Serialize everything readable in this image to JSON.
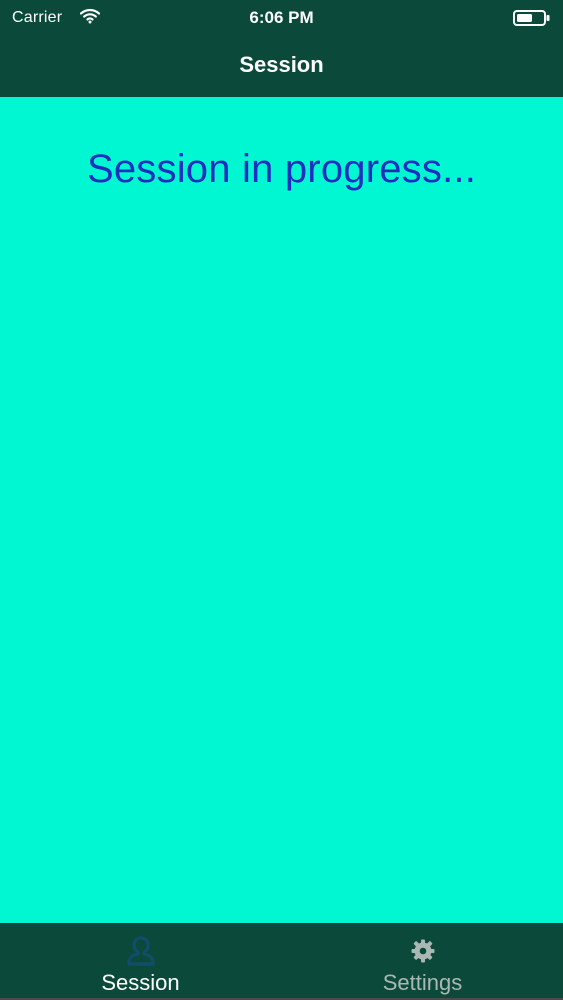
{
  "status_bar": {
    "carrier": "Carrier",
    "time": "6:06 PM",
    "wifi_icon": "wifi-icon",
    "battery_icon": "battery-icon"
  },
  "nav": {
    "title": "Session"
  },
  "main": {
    "status_text": "Session in progress..."
  },
  "tab_bar": {
    "tabs": [
      {
        "label": "Session",
        "icon": "person-icon",
        "selected": true
      },
      {
        "label": "Settings",
        "icon": "gear-icon",
        "selected": false
      }
    ]
  },
  "colors": {
    "bar_background": "#0b4a3a",
    "content_background": "#00f7d2",
    "status_text": "#1d2fbf",
    "tab_selected_icon": "#0f4d6a",
    "tab_unselected": "#aab7b2"
  }
}
